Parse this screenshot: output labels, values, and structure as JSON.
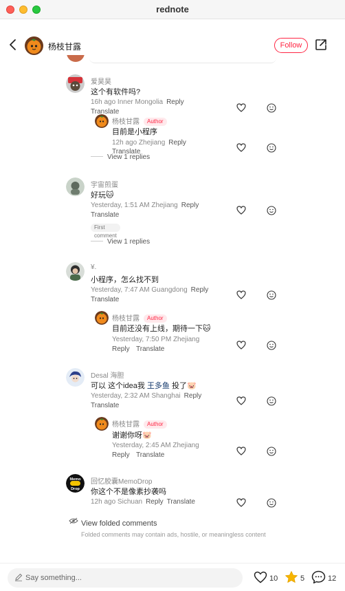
{
  "window": {
    "title": "rednote"
  },
  "header": {
    "author": "杨枝甘露",
    "follow_label": "Follow"
  },
  "comments": [
    {
      "user": "爱昊昊",
      "text": "这个有软件吗?",
      "meta": "16h ago Inner Mongolia",
      "reply": "Reply",
      "translate": "Translate",
      "replies": [
        {
          "user": "杨枝甘露",
          "badge": "Author",
          "text": "目前是小程序",
          "meta": "12h ago Zhejiang",
          "reply": "Reply",
          "translate": "Translate"
        }
      ],
      "view_replies": "View 1 replies"
    },
    {
      "user": "宇宙煎蛋",
      "text": "好玩🐱",
      "meta": "Yesterday, 1:51 AM Zhejiang",
      "reply": "Reply",
      "translate": "Translate",
      "tag": "First comment",
      "view_replies": "View 1 replies"
    },
    {
      "user": "¥.",
      "text": "小程序，怎么找不到",
      "meta": "Yesterday, 7:47 AM Guangdong",
      "reply": "Reply",
      "translate": "Translate",
      "replies": [
        {
          "user": "杨枝甘露",
          "badge": "Author",
          "text": "目前还没有上线，期待一下🐱",
          "meta": "Yesterday, 7:50 PM Zhejiang",
          "reply": "Reply",
          "translate": "Translate"
        }
      ]
    },
    {
      "user": "Desal 海胆",
      "text_before": "可以 这个idea我 ",
      "text_link": "王多鱼",
      "text_after": " 投了🐷",
      "meta": "Yesterday, 2:32 AM Shanghai",
      "reply": "Reply",
      "translate": "Translate",
      "replies": [
        {
          "user": "杨枝甘露",
          "badge": "Author",
          "text": "谢谢你呀🐷",
          "meta": "Yesterday, 2:45 AM Zhejiang",
          "reply": "Reply",
          "translate": "Translate"
        }
      ]
    },
    {
      "user": "回忆胶囊MemoDrop",
      "text": "你这个不是像素抄袭吗",
      "meta": "12h ago Sichuan",
      "reply": "Reply",
      "translate": "Translate",
      "avatar_text": "Memo Drop"
    }
  ],
  "folded": {
    "title": "View folded comments",
    "desc": "Folded comments may contain ads, hostile, or meaningless content"
  },
  "bottom": {
    "placeholder": "Say something...",
    "likes": "10",
    "stars": "5",
    "comments": "12"
  },
  "icons": [
    "chevron-left-icon",
    "share-icon",
    "heart-icon",
    "smile-icon",
    "eye-icon",
    "pencil-icon",
    "star-icon",
    "chat-icon"
  ],
  "colors": {
    "accent": "#ff2442",
    "star": "#f7b500",
    "link": "#13386c"
  }
}
